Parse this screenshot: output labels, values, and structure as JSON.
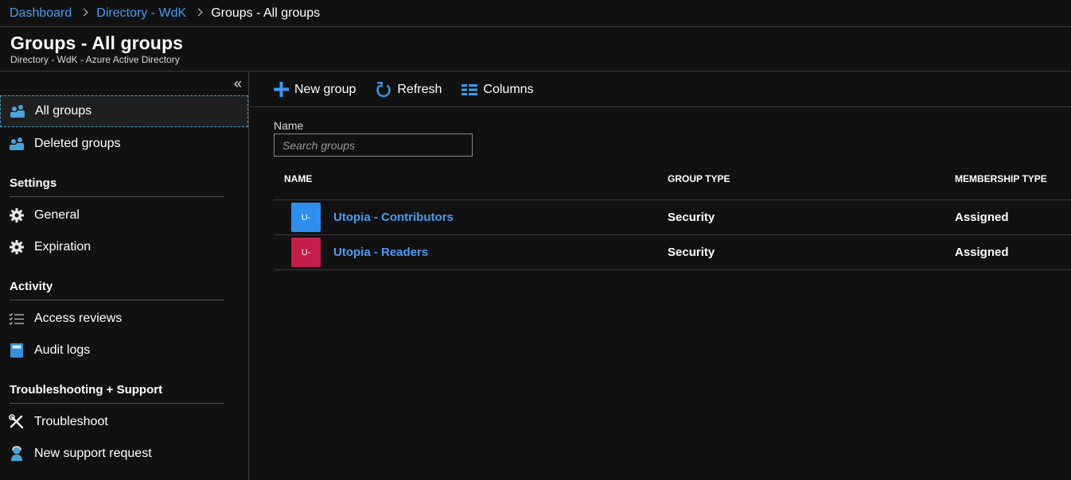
{
  "breadcrumb": {
    "items": [
      "Dashboard",
      "Directory - WdK"
    ],
    "current": "Groups - All groups"
  },
  "header": {
    "title": "Groups - All groups",
    "subtitle": "Directory - WdK - Azure Active Directory"
  },
  "sidebar": {
    "collapse_glyph": "«",
    "items": [
      "All groups",
      "Deleted groups"
    ],
    "settings": {
      "heading": "Settings",
      "items": [
        "General",
        "Expiration"
      ]
    },
    "activity": {
      "heading": "Activity",
      "items": [
        "Access reviews",
        "Audit logs"
      ]
    },
    "support": {
      "heading": "Troubleshooting + Support",
      "items": [
        "Troubleshoot",
        "New support request"
      ]
    }
  },
  "toolbar": {
    "new_group": "New group",
    "refresh": "Refresh",
    "columns": "Columns"
  },
  "filter": {
    "label": "Name",
    "placeholder": "Search groups"
  },
  "table": {
    "headers": [
      "NAME",
      "GROUP TYPE",
      "MEMBERSHIP TYPE"
    ],
    "rows": [
      {
        "initials": "U-",
        "color": "#2d8ef0",
        "name": "Utopia - Contributors",
        "group_type": "Security",
        "membership_type": "Assigned"
      },
      {
        "initials": "U-",
        "color": "#c41d4a",
        "name": "Utopia - Readers",
        "group_type": "Security",
        "membership_type": "Assigned"
      }
    ]
  },
  "colors": {
    "accent": "#4a9cf0",
    "icon_blue": "#4aa4d8",
    "background": "#111112"
  }
}
